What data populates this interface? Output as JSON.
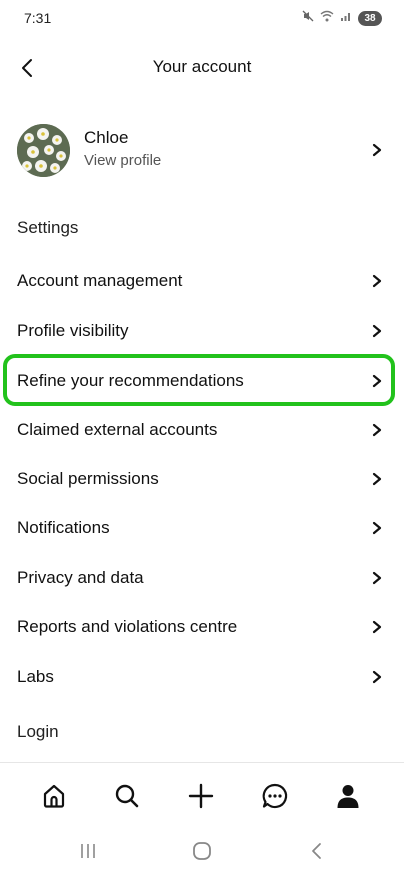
{
  "status_bar": {
    "time": "7:31",
    "battery": "38",
    "icons": [
      "mute-icon",
      "wifi-icon",
      "signal-icon",
      "battery-icon"
    ]
  },
  "header": {
    "title": "Your account",
    "back_icon": "back-arrow-icon"
  },
  "profile": {
    "name": "Chloe",
    "subtitle": "View profile"
  },
  "settings_section": {
    "label": "Settings",
    "items": [
      {
        "label": "Account management"
      },
      {
        "label": "Profile visibility"
      },
      {
        "label": "Refine your recommendations"
      },
      {
        "label": "Claimed external accounts"
      },
      {
        "label": "Social permissions"
      },
      {
        "label": "Notifications"
      },
      {
        "label": "Privacy and data"
      },
      {
        "label": "Reports and violations centre"
      },
      {
        "label": "Labs"
      }
    ]
  },
  "login": {
    "label": "Login"
  },
  "bottom_nav": {
    "items": [
      "home-icon",
      "search-icon",
      "create-plus-icon",
      "messages-icon",
      "profile-icon"
    ]
  },
  "system_nav": {
    "items": [
      "recents-icon",
      "home-circle-icon",
      "system-back-icon"
    ]
  },
  "colors": {
    "highlight": "#22c21c",
    "text": "#111111",
    "muted": "#555555"
  }
}
